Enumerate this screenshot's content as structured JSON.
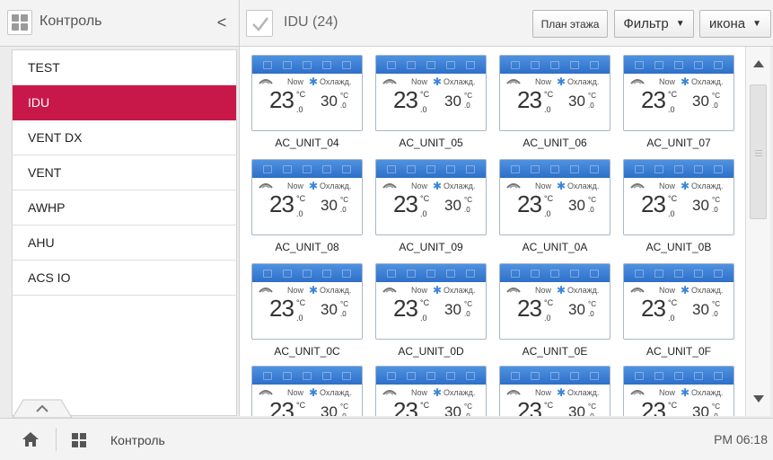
{
  "topbar": {
    "title": "Контроль",
    "collapse": "<",
    "group_label": "IDU (24)",
    "floor_plan": "План этажа",
    "filter": "Фильтр",
    "view": "икона"
  },
  "sidebar": {
    "items": [
      {
        "label": "TEST",
        "active": false
      },
      {
        "label": "IDU",
        "active": true
      },
      {
        "label": "VENT DX",
        "active": false
      },
      {
        "label": "VENT",
        "active": false
      },
      {
        "label": "AWHP",
        "active": false
      },
      {
        "label": "AHU",
        "active": false
      },
      {
        "label": "ACS IO",
        "active": false
      }
    ]
  },
  "units": [
    {
      "name": "AC_UNIT_04"
    },
    {
      "name": "AC_UNIT_05"
    },
    {
      "name": "AC_UNIT_06"
    },
    {
      "name": "AC_UNIT_07"
    },
    {
      "name": "AC_UNIT_08"
    },
    {
      "name": "AC_UNIT_09"
    },
    {
      "name": "AC_UNIT_0A"
    },
    {
      "name": "AC_UNIT_0B"
    },
    {
      "name": "AC_UNIT_0C"
    },
    {
      "name": "AC_UNIT_0D"
    },
    {
      "name": "AC_UNIT_0E"
    },
    {
      "name": "AC_UNIT_0F"
    },
    {
      "name": ""
    },
    {
      "name": ""
    },
    {
      "name": ""
    },
    {
      "name": ""
    }
  ],
  "unit_display": {
    "now": "Now",
    "mode": "Охлажд.",
    "current_temp": "23",
    "current_dec": ".0",
    "set_temp": "30",
    "set_dec": ".0",
    "unit": "°C"
  },
  "bottombar": {
    "title": "Контроль",
    "time": "PM 06:18"
  },
  "colors": {
    "accent": "#c8184a",
    "card_header": "#3a7fd5"
  }
}
